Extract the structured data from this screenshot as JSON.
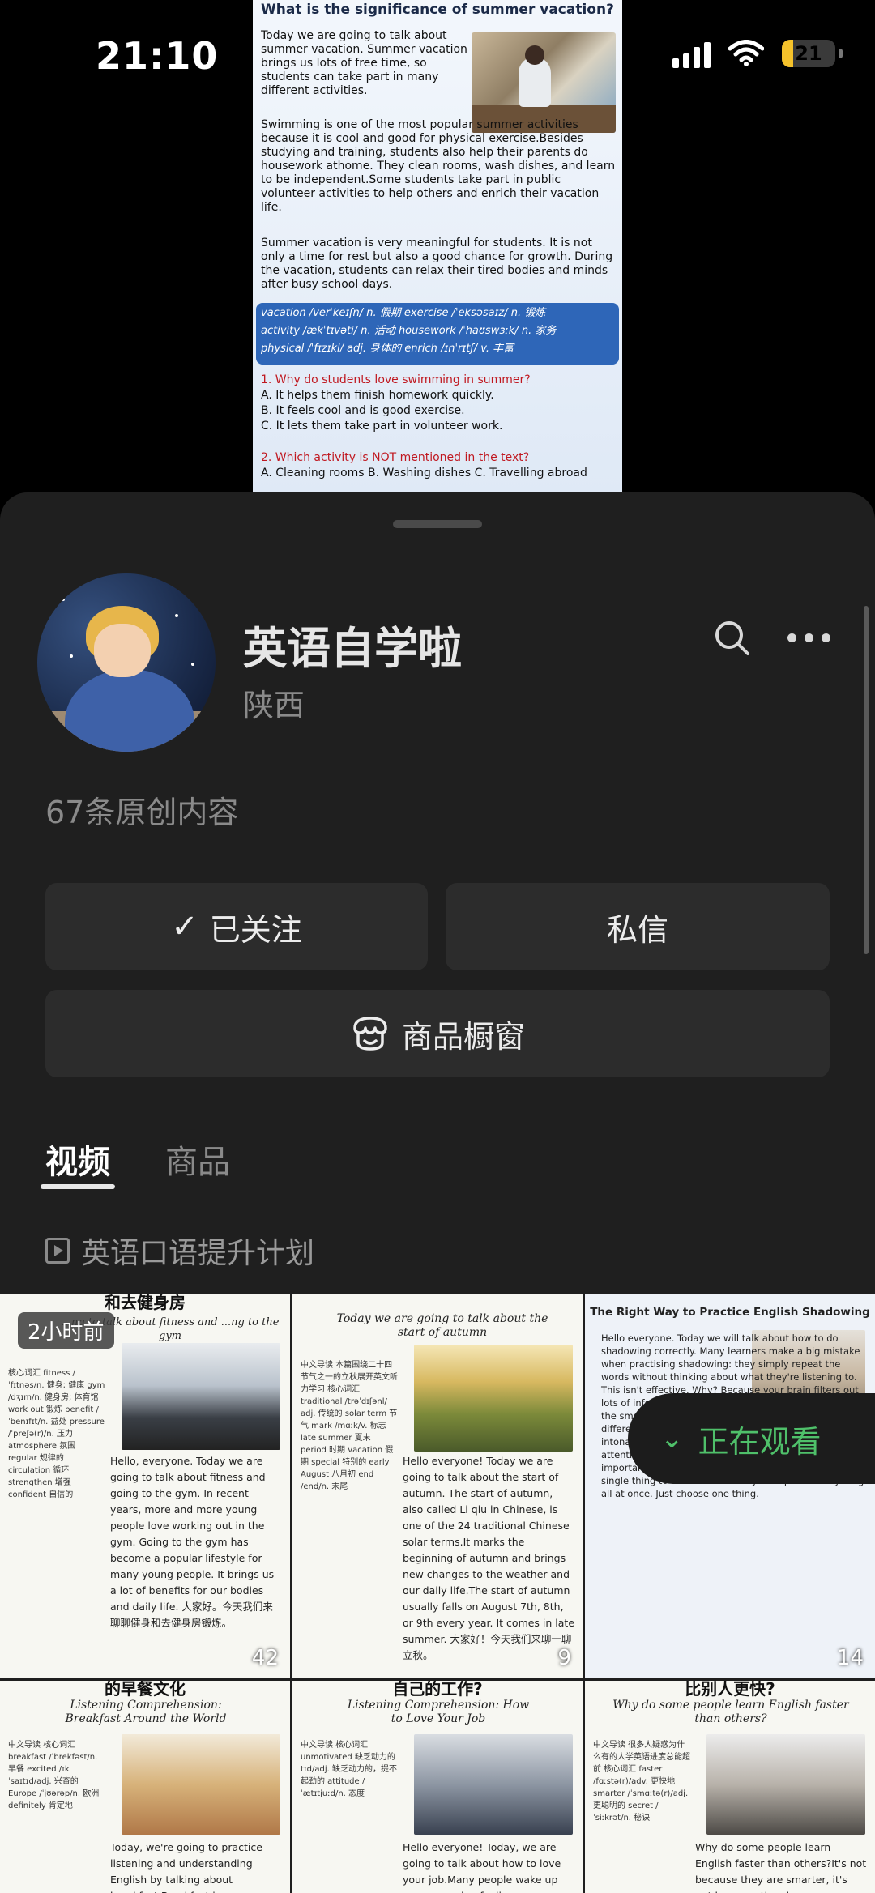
{
  "status_bar": {
    "time": "21:10",
    "battery": "21",
    "battery_fill": 0.21
  },
  "article": {
    "title": "What is the significance of summer vacation?",
    "intro": "Today we are going to talk about summer vacation. Summer vacation brings us lots of free time, so students can take part in many different activities.",
    "para1": "Swimming is one of the most popular summer activities because it is cool and good for physical exercise.Besides studying and training, students also help their parents do housework athome. They clean rooms, wash dishes, and learn to be independent.Some students take part in public volunteer activities to help others and enrich their vacation life.",
    "para2": "Summer vacation is very meaningful for students. It is not only a time for rest but also a good chance for growth. During the vacation, students can relax their tired bodies and minds after busy school days.",
    "vocab_line1": "vacation /verˈkeɪʃn/ n. 假期  exercise /ˈeksəsaɪz/ n. 锻炼",
    "vocab_line2": "activity /ækˈtɪvəti/ n. 活动  housework /ˈhaʊswɜːk/ n. 家务",
    "vocab_line3": "physical /ˈfɪzɪkl/ adj. 身体的  enrich /ɪnˈrɪtʃ/ v. 丰富",
    "q1": "1. Why do students love swimming in summer?",
    "q1a": "A. It helps them finish homework quickly.",
    "q1b": "B. It feels cool and is good exercise.",
    "q1c": "C. It lets them take part in volunteer work.",
    "q2": "2. Which activity is NOT mentioned in the text?",
    "q2opts": "A. Cleaning rooms    B. Washing dishes  C. Travelling abroad"
  },
  "profile": {
    "name": "英语自学啦",
    "region": "陕西",
    "original_count": "67条原创内容",
    "follow_label": "已关注",
    "message_label": "私信",
    "shop_label": "商品橱窗"
  },
  "tabs": {
    "videos": "视频",
    "goods": "商品"
  },
  "playlist": "英语口语提升计划",
  "watching_label": "正在观看",
  "cards": [
    {
      "big": "和去健身房",
      "subtitle": "...ng to talk about fitness and ...ng to the gym",
      "time": "2小时前",
      "side": "核心词汇 fitness /ˈfɪtnəs/n. 健身; 健康 gym /dʒɪm/n. 健身房; 体育馆 work out 锻炼 benefit /ˈbenɪfɪt/n. 益处 pressure /ˈpreʃə(r)/n. 压力 atmosphere 氛围 regular 规律的 circulation 循环 strengthen 增强 confident 自信的",
      "body": "Hello, everyone. Today we are going to talk about fitness and going to the gym. In recent years, more and more young people love working out in the gym. Going to the gym has become a popular lifestyle for many young people. It brings us a lot of benefits for our bodies and daily life. 大家好。今天我们来聊聊健身和去健身房锻炼。",
      "count": "42"
    },
    {
      "big": "",
      "subtitle": "Today we are going to talk about the start of autumn",
      "time": "",
      "side": "中文导读 本篇围绕二十四节气之一的立秋展开英文听力学习 核心词汇 traditional /trəˈdɪʃənl/ adj. 传统的 solar term 节气 mark /mɑːk/v. 标志 late summer 夏末 period 时期 vacation 假期 special 特别的 early August 八月初 end /end/n. 末尾",
      "body": "Hello everyone! Today we are going to talk about the start of autumn. The start of autumn, also called Li qiu in Chinese, is one of the 24 traditional Chinese solar terms.It marks the beginning of autumn and brings new changes to the weather and our daily life.The start of autumn usually falls on August 7th, 8th, or 9th every year. It comes in late summer. 大家好！今天我们来聊一聊立秋。",
      "count": "9"
    },
    {
      "big": "",
      "subtitle": "The Right Way to Practice English Shadowing",
      "time": "",
      "side": "",
      "body": "Hello everyone. Today we will talk about how to do shadowing correctly. Many learners make a big mistake when practising shadowing: they simply repeat the words without thinking about what they're listening to. This isn't effective. Why? Because your brain filters out lots of information. You hear the words, yet you miss all the small details. For example, you may fail to tell the difference between ship and sheep, or miss the intonation at the end of a sentence. Without close attention, you won't make progress. So here's the most important rule: set an intention. That means picking one single thing to focus on. Don't try to improve everything all at once. Just choose one thing.",
      "count": "14"
    },
    {
      "big": "的早餐文化",
      "subtitle": "Listening Comprehension: Breakfast Around the World",
      "time": "",
      "side": "中文导读 核心词汇 breakfast /ˈbrekfəst/n. 早餐 excited /ɪkˈsaɪtɪd/adj. 兴奋的 Europe /ˈjʊərəp/n. 欧洲 definitely 肯定地",
      "body": "Today, we're going to practice listening and understanding English by talking about breakfast.Breakfast is my favorite meal of the day, so I'm",
      "count": ""
    },
    {
      "big": "自己的工作?",
      "subtitle": "Listening Comprehension: How to Love Your Job",
      "time": "",
      "side": "中文导读 核心词汇 unmotivated 缺乏动力的 tɪd/adj. 缺乏动力的，提不起劲的 attitude /ˈætɪtjuːd/n. 态度",
      "body": "Hello everyone! Today, we are going to talk about how to love your job.Many people wake up every morning feeling",
      "count": ""
    },
    {
      "big": "比别人更快?",
      "subtitle": "Why do some people learn English faster than others?",
      "time": "",
      "side": "中文导读 很多人疑惑为什么有的人学英语进度总能超前 核心词汇 faster /fɑːstə(r)/adv. 更快地 smarter /ˈsmɑːtə(r)/adj. 更聪明的 secret /ˈsiːkrət/n. 秘诀",
      "body": "Why do some people learn English faster than others?It's not because they are smarter, it's not because they have more time. The secret is",
      "count": ""
    }
  ],
  "colors": {
    "sheet_bg": "#1f1f1f",
    "accent_green": "#4fc06a",
    "vocab_blue": "#2e66b8",
    "question_red": "#c01820"
  }
}
